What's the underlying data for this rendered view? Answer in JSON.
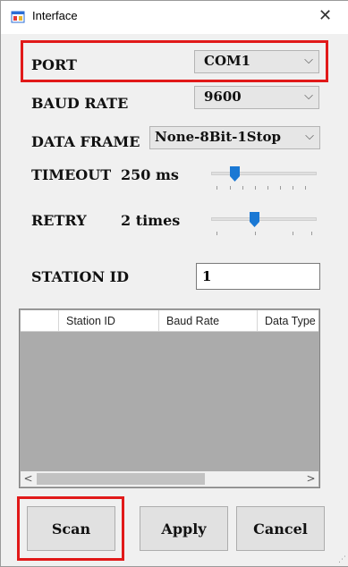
{
  "window": {
    "title": "Interface",
    "close_glyph": "✕"
  },
  "port": {
    "label": "PORT",
    "value": "COM1"
  },
  "baud_rate": {
    "label": "BAUD RATE",
    "value": "9600"
  },
  "data_frame": {
    "label": "DATA FRAME",
    "value": "None-8Bit-1Stop"
  },
  "timeout": {
    "label": "TIMEOUT",
    "value": "250 ms",
    "slider_level": 0.2
  },
  "retry": {
    "label": "RETRY",
    "value": "2 times",
    "slider_level": 0.4
  },
  "station_id": {
    "label": "STATION ID",
    "value": "1"
  },
  "table": {
    "columns": [
      "",
      "Station ID",
      "Baud Rate",
      "Data Type"
    ],
    "rows": []
  },
  "buttons": {
    "scan": "Scan",
    "apply": "Apply",
    "cancel": "Cancel"
  },
  "colors": {
    "highlight": "#e11919",
    "slider_thumb": "#1a78d4",
    "grid_bg": "#ababab"
  },
  "icons": {
    "app": "app-window-icon",
    "chevron": "chevron-down-icon"
  }
}
